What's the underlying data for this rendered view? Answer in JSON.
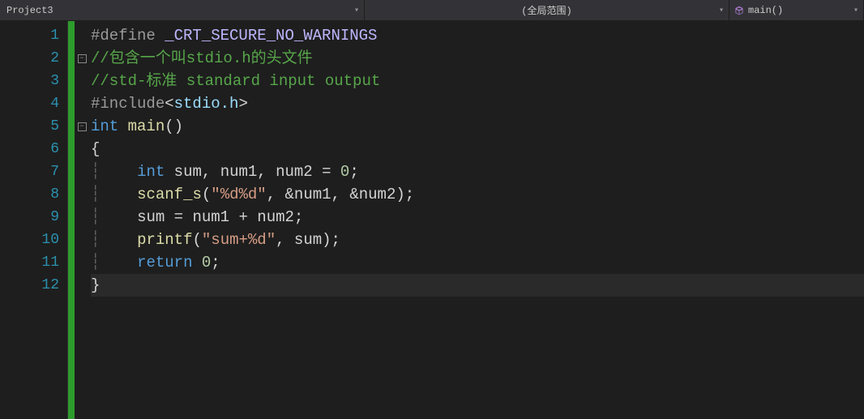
{
  "topbar": {
    "project": "Project3",
    "scope": "(全局范围)",
    "func": "main()"
  },
  "gutter": {
    "l1": "1",
    "l2": "2",
    "l3": "3",
    "l4": "4",
    "l5": "5",
    "l6": "6",
    "l7": "7",
    "l8": "8",
    "l9": "9",
    "l10": "10",
    "l11": "11",
    "l12": "12"
  },
  "fold": {
    "minus": "−"
  },
  "code": {
    "l1": {
      "dir": "#define ",
      "macro": "_CRT_SECURE_NO_WARNINGS"
    },
    "l2": {
      "cm": "//包含一个叫stdio.h的头文件"
    },
    "l3": {
      "cm": "//std-标准 standard input output"
    },
    "l4": {
      "dir": "#include",
      "ang1": "<",
      "hdr": "stdio.h",
      "ang2": ">"
    },
    "l5": {
      "kw": "int",
      "sp": " ",
      "fn": "main",
      "par": "()"
    },
    "l6": {
      "brace": "{"
    },
    "l7": {
      "indent": "    ",
      "kw": "int",
      "rest": " sum, num1, num2 = ",
      "num": "0",
      "semi": ";"
    },
    "l8": {
      "indent": "    ",
      "fn": "scanf_s",
      "open": "(",
      "str": "\"%d%d\"",
      "args": ", &num1, &num2)",
      "semi": ";"
    },
    "l9": {
      "indent": "    ",
      "txt": "sum = num1 + num2;"
    },
    "l10": {
      "indent": "    ",
      "fn": "printf",
      "open": "(",
      "str": "\"sum+%d\"",
      "args": ", sum)",
      "semi": ";"
    },
    "l11": {
      "indent": "    ",
      "kw": "return",
      "sp": " ",
      "num": "0",
      "semi": ";"
    },
    "l12": {
      "brace": "}"
    }
  }
}
